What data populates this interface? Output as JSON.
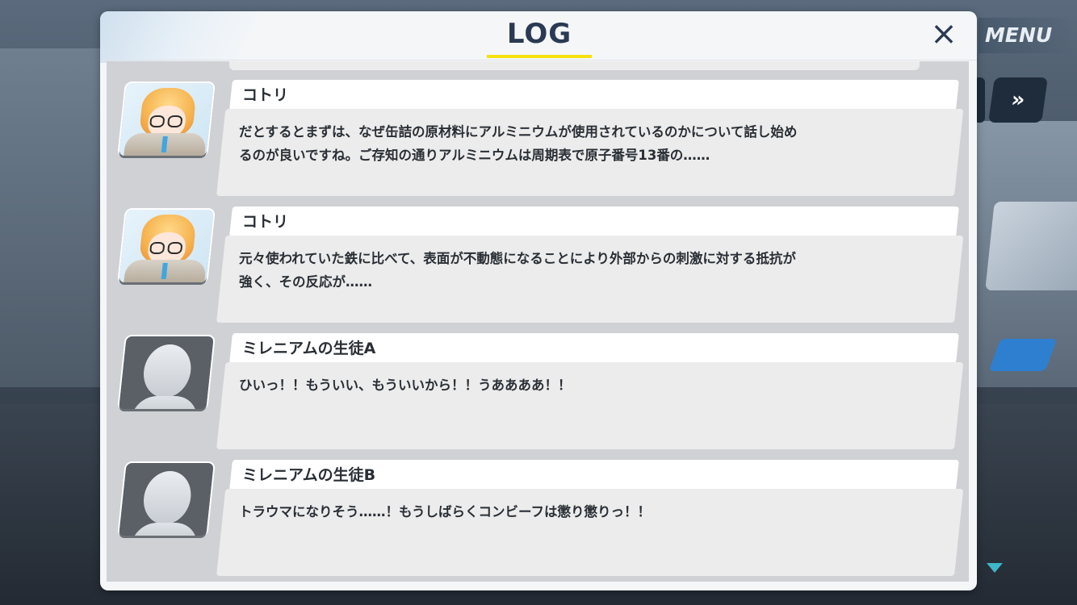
{
  "header": {
    "title": "LOG",
    "close_label": "×"
  },
  "hud": {
    "menu_label": "MENU",
    "fast_forward_label": "»"
  },
  "log": [
    {
      "speaker": "コトリ",
      "avatar": "kotori-portrait",
      "text": "だとするとまずは、なぜ缶詰の原材料にアルミニウムが使用されているのかについて話し始め\nるのが良いですね。ご存知の通りアルミニウムは周期表で原子番号13番の……"
    },
    {
      "speaker": "コトリ",
      "avatar": "kotori-portrait",
      "text": "元々使われていた鉄に比べて、表面が不動態になることにより外部からの刺激に対する抵抗が\n強く、その反応が……"
    },
    {
      "speaker": "ミレニアムの生徒A",
      "avatar": "generic-silhouette",
      "text": "ひいっ！！もういい、もういいから！！うああああ！！"
    },
    {
      "speaker": "ミレニアムの生徒B",
      "avatar": "generic-silhouette",
      "text": "トラウマになりそう……！もうしばらくコンビーフは懲り懲りっ！！"
    }
  ],
  "colors": {
    "accent_underline": "#f5e20f",
    "title_color": "#2a3a52",
    "scroll_indicator": "#3fb6c9"
  }
}
